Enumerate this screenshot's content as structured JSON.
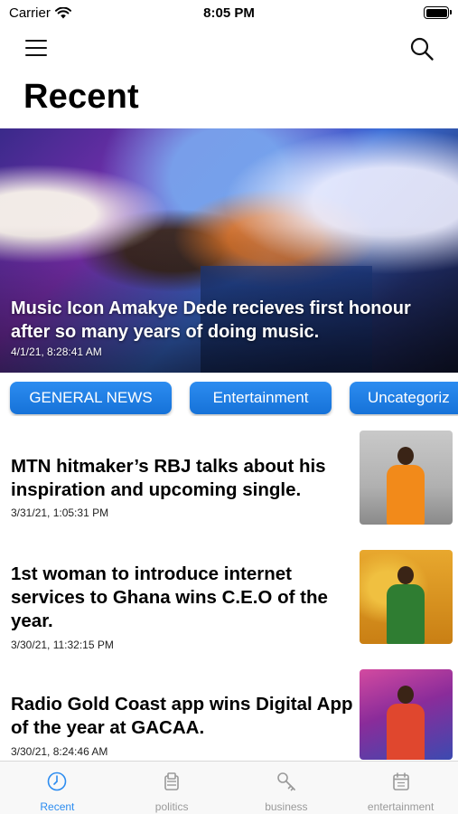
{
  "status_bar": {
    "carrier": "Carrier",
    "time": "8:05 PM",
    "icons": [
      "wifi-icon",
      "battery-icon"
    ]
  },
  "nav": {
    "icons": [
      "hamburger-menu-icon",
      "search-icon"
    ]
  },
  "page": {
    "title": "Recent"
  },
  "featured": {
    "headline": "Music Icon Amakye Dede recieves first honour after so many years of doing music.",
    "date": "4/1/21, 8:28:41 AM"
  },
  "categories": [
    "GENERAL NEWS",
    "Entertainment",
    "Uncategoriz"
  ],
  "articles": [
    {
      "title": "MTN hitmaker’s RBJ talks about his inspiration and upcoming single.",
      "date": "3/31/21, 1:05:31 PM"
    },
    {
      "title": "1st woman to introduce internet services to Ghana wins C.E.O of the year.",
      "date": "3/30/21, 11:32:15 PM"
    },
    {
      "title": "Radio Gold Coast app wins Digital App of the year at GACAA.",
      "date": "3/30/21, 8:24:46 AM"
    }
  ],
  "tabs": [
    {
      "label": "Recent",
      "icon": "clock-icon",
      "active": true
    },
    {
      "label": "politics",
      "icon": "ballot-icon",
      "active": false
    },
    {
      "label": "business",
      "icon": "key-icon",
      "active": false
    },
    {
      "label": "entertainment",
      "icon": "calendar-icon",
      "active": false
    }
  ],
  "colors": {
    "accent": "#2c8cf0",
    "inactive_tab": "#9a9a9a"
  }
}
